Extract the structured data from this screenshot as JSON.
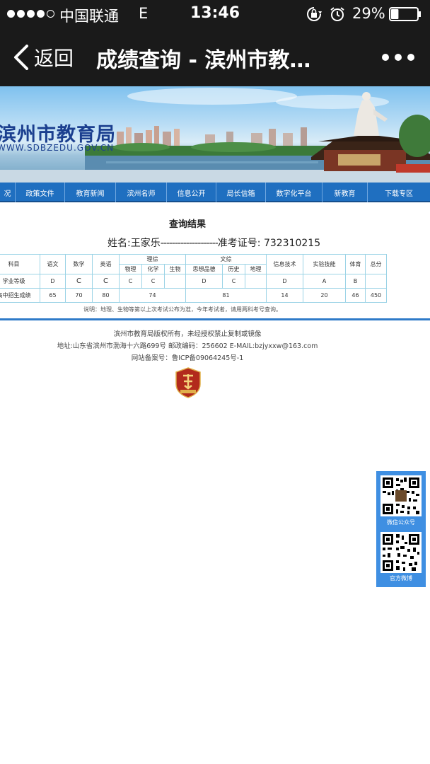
{
  "status_bar": {
    "carrier": "中国联通",
    "network": "E",
    "time": "13:46",
    "battery": "29%",
    "battery_level": 0.29,
    "icons": [
      "signal-dots-icon",
      "rotation-lock-icon",
      "alarm-icon",
      "battery-icon"
    ]
  },
  "nav": {
    "back_label": "返回",
    "title": "成绩查询 - 滨州市教…"
  },
  "banner": {
    "site_name": "滨州市教育局",
    "site_url": "WWW.SDBZEDU.GOV.CN"
  },
  "menu": [
    {
      "label": "况"
    },
    {
      "label": "政策文件"
    },
    {
      "label": "教育新闻"
    },
    {
      "label": "滨州名师"
    },
    {
      "label": "信息公开"
    },
    {
      "label": "局长信箱"
    },
    {
      "label": "数字化平台"
    },
    {
      "label": "新教育"
    },
    {
      "label": "下载专区"
    }
  ],
  "result": {
    "title": "查询结果",
    "name_label": "姓名:",
    "name": "王家乐",
    "separator": "--------------------",
    "exam_label": "准考证号:",
    "exam_no": "732310215"
  },
  "table": {
    "h_subject": "科目",
    "h_chinese": "语文",
    "h_math": "数学",
    "h_english": "英语",
    "h_science": "理综",
    "h_physics": "物理",
    "h_chemistry": "化学",
    "h_biology": "生物",
    "h_arts": "文综",
    "h_politics": "思想品德",
    "h_history": "历史",
    "h_geography": "地理",
    "h_it": "信息技术",
    "h_lab": "实验技能",
    "h_pe": "体育",
    "h_total": "总分",
    "row1": {
      "label": "学业等级",
      "chinese": "D",
      "math": "C",
      "english": "C",
      "physics": "C",
      "chemistry": "C",
      "biology": "",
      "politics": "D",
      "history": "C",
      "geography": "",
      "it": "D",
      "lab": "A",
      "pe": "B",
      "total": ""
    },
    "row2": {
      "label": "高中招生成绩",
      "chinese": "65",
      "math": "70",
      "english": "80",
      "science": "74",
      "arts": "81",
      "it": "14",
      "lab": "20",
      "pe": "46",
      "total": "450"
    }
  },
  "note": "说明：地理、生物等第以上次考试公布为准，今年考试者，请用两科考号查询。",
  "footer": {
    "copyright": "滨州市教育局版权所有，未经授权禁止复制或镜像",
    "address": "地址:山东省滨州市渤海十六路699号 邮政编码：256602 E-MAIL:bzjyxxw@163.com",
    "icp": "网站备案号：鲁ICP备09064245号-1",
    "badge_icon": "party-government-badge-icon"
  },
  "qr": {
    "wechat_label": "微信公众号",
    "weibo_label": "官方微博"
  },
  "colors": {
    "top_bar": "#1a1a1a",
    "menu_blue": "#1f6fc0",
    "table_border": "#9bd3e6",
    "divider": "#2e7ac8",
    "qr_panel": "#3f8fe2",
    "site_name": "#1b3f8f"
  }
}
